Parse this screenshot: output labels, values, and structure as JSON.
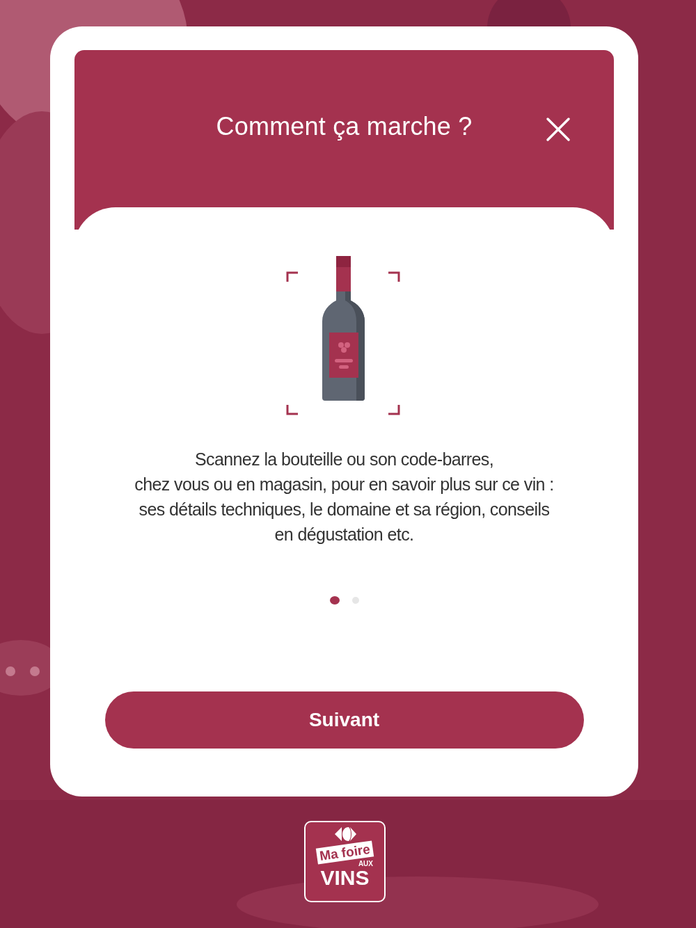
{
  "dialog": {
    "title": "Comment ça marche ?",
    "text": "Scannez la bouteille ou son code-barres,\nchez vous ou en magasin, pour en savoir plus sur ce vin :\nses détails techniques, le domaine et sa région, conseils\nen dégustation etc.",
    "pages": [
      {
        "selected": true
      },
      {
        "selected": false
      }
    ],
    "button": "Suivant"
  },
  "logo": {
    "line_1": "Ma foire",
    "line_2": "AUX",
    "line_3": "VINS"
  }
}
